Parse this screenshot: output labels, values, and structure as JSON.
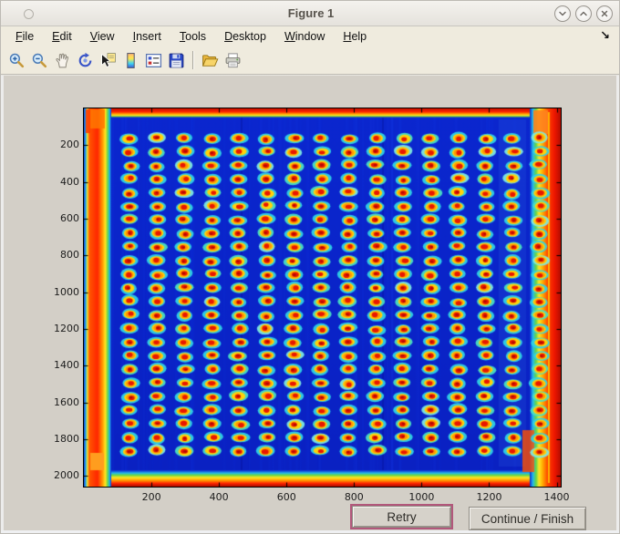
{
  "window": {
    "title": "Figure 1",
    "controls": [
      {
        "name": "minimize"
      },
      {
        "name": "maximize"
      },
      {
        "name": "close"
      }
    ]
  },
  "menu_bar": {
    "items": [
      {
        "label": "File",
        "underline_index": 0
      },
      {
        "label": "Edit",
        "underline_index": 0
      },
      {
        "label": "View",
        "underline_index": 0
      },
      {
        "label": "Insert",
        "underline_index": 0
      },
      {
        "label": "Tools",
        "underline_index": 0
      },
      {
        "label": "Desktop",
        "underline_index": 0
      },
      {
        "label": "Window",
        "underline_index": 0
      },
      {
        "label": "Help",
        "underline_index": 0
      }
    ],
    "dock_arrow": "↘"
  },
  "toolbar": {
    "buttons": [
      {
        "name": "zoom-in"
      },
      {
        "name": "zoom-out"
      },
      {
        "name": "pan"
      },
      {
        "name": "rotate-3d"
      },
      {
        "name": "data-cursor"
      },
      {
        "name": "colorbar"
      },
      {
        "name": "legend"
      },
      {
        "name": "save"
      },
      {
        "name": "separator"
      },
      {
        "name": "open"
      },
      {
        "name": "print"
      }
    ]
  },
  "chart_data": {
    "type": "heatmap",
    "description": "Jet-colormap scan image of a 384-well plate: 16 columns x 24 rows of spots (red centers, yellow-orange rings, cyan halos) on a blue field with saturated red border bands",
    "x_ticks": [
      200,
      400,
      600,
      800,
      1000,
      1200,
      1400
    ],
    "y_ticks": [
      200,
      400,
      600,
      800,
      1000,
      1200,
      1400,
      1600,
      1800,
      2000
    ],
    "x_range": [
      0,
      1412
    ],
    "y_range": [
      0,
      2058
    ],
    "plate": {
      "columns": 16,
      "rows": 24,
      "first_center": {
        "x": 136,
        "y": 163
      },
      "spacing": {
        "x": 81,
        "y": 74
      }
    },
    "palette": {
      "background": "#0b27cf",
      "background2": "#0a21c2",
      "spot_halo": "#2fd2e6",
      "spot_halo_alt": "#49dfc3",
      "spot_ring": "#ffd20a",
      "spot_orange": "#ff9100",
      "spot_center": "#e81700",
      "spot_core": "#ad0800",
      "border_red": "#ff2600",
      "border_orange": "#ff9900",
      "border_yellow": "#ffe622",
      "border_green": "#62d649",
      "border_cyan": "#23b8ec",
      "edge_dark": "#b40d00"
    }
  },
  "action_buttons": {
    "retry": "Retry",
    "continue_finish": "Continue / Finish"
  }
}
